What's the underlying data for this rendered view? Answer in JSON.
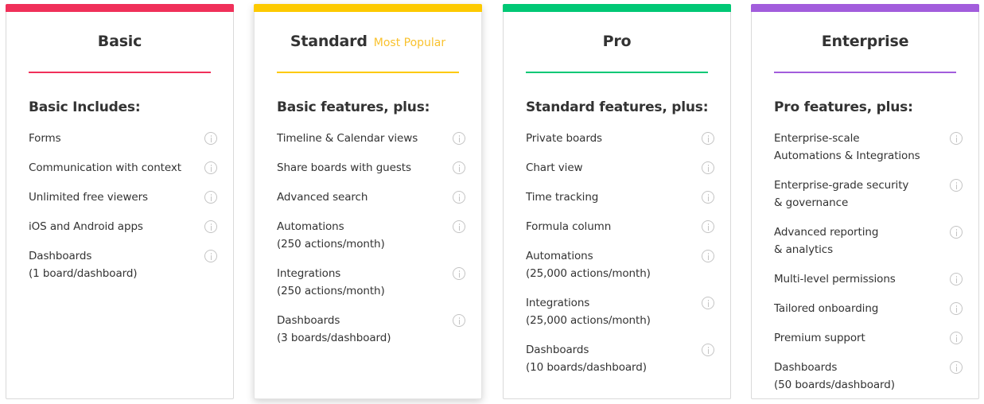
{
  "plans": [
    {
      "name": "Basic",
      "badge": "",
      "accent": "#f0305a",
      "subhead": "Basic Includes:",
      "features": [
        "Forms",
        "Communication with context",
        "Unlimited free viewers",
        "iOS and Android apps",
        "Dashboards\n(1 board/dashboard)"
      ]
    },
    {
      "name": "Standard",
      "badge": "Most Popular",
      "accent": "#fdca00",
      "subhead": "Basic features, plus:",
      "features": [
        "Timeline & Calendar views",
        "Share boards with guests",
        "Advanced search",
        "Automations\n(250 actions/month)",
        "Integrations\n(250 actions/month)",
        "Dashboards\n(3 boards/dashboard)"
      ]
    },
    {
      "name": "Pro",
      "badge": "",
      "accent": "#00c875",
      "subhead": "Standard features, plus:",
      "features": [
        "Private boards",
        "Chart view",
        "Time tracking",
        "Formula column",
        "Automations\n(25,000 actions/month)",
        "Integrations\n(25,000 actions/month)",
        "Dashboards\n(10 boards/dashboard)"
      ]
    },
    {
      "name": "Enterprise",
      "badge": "",
      "accent": "#a25ddc",
      "subhead": "Pro features, plus:",
      "features": [
        "Enterprise-scale\nAutomations & Integrations",
        "Enterprise-grade security\n& governance",
        "Advanced reporting\n& analytics",
        "Multi-level permissions",
        "Tailored onboarding",
        "Premium support",
        "Dashboards\n(50 boards/dashboard)"
      ]
    }
  ],
  "icons": {
    "feature_info": "info-circle-icon"
  }
}
